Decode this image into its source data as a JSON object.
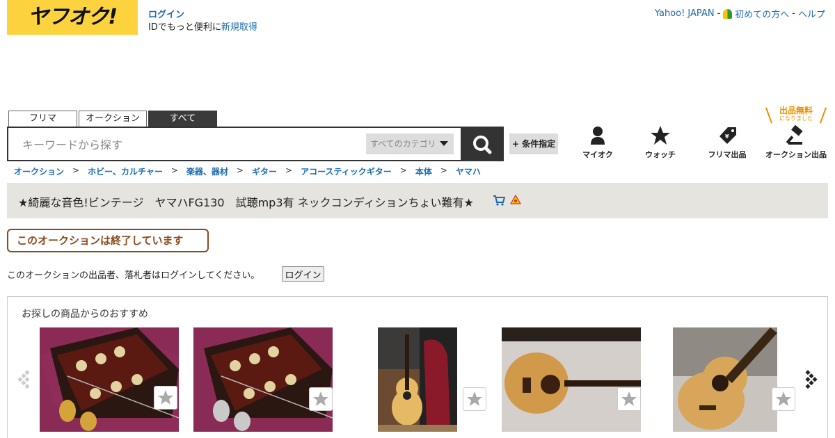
{
  "header": {
    "logo_text": "ヤフオク!",
    "login": "ログイン",
    "login_sub_prefix": "IDでもっと便利に",
    "register": "新規取得",
    "yahoo_japan": "Yahoo! JAPAN",
    "beginners": "初めての方へ",
    "help": "ヘルプ",
    "separator": "-"
  },
  "search": {
    "tabs": [
      "フリマ",
      "オークション",
      "すべて"
    ],
    "active_tab": "すべて",
    "placeholder": "キーワードから探す",
    "category": "すべてのカテゴリ",
    "conditions": "+ 条件指定"
  },
  "nav": {
    "myauction": "マイオク",
    "watch": "ウォッチ",
    "flea_listing": "フリマ出品",
    "auction_listing": "オークション出品",
    "promo_title": "出品無料",
    "promo_sub": "になりました"
  },
  "breadcrumb": [
    "オークション",
    "ホビー、カルチャー",
    "楽器、器材",
    "ギター",
    "アコースティックギター",
    "本体",
    "ヤマハ"
  ],
  "breadcrumb_sep": ">",
  "item": {
    "title": "★綺麗な音色!ビンテージ　ヤマハFG130　試聴mp3有 ネックコンディションちょい難有★"
  },
  "status": {
    "ended": "このオークションは終了しています",
    "notice": "このオークションの出品者、落札者はログインしてください。",
    "login_button": "ログイン"
  },
  "recommend": {
    "heading": "お探しの商品からのおすすめ"
  },
  "colors": {
    "brand_yellow": "#fcd33f",
    "link": "#1c6bb0",
    "ended_border": "#8b4a1c",
    "promo_orange": "#f09000"
  }
}
